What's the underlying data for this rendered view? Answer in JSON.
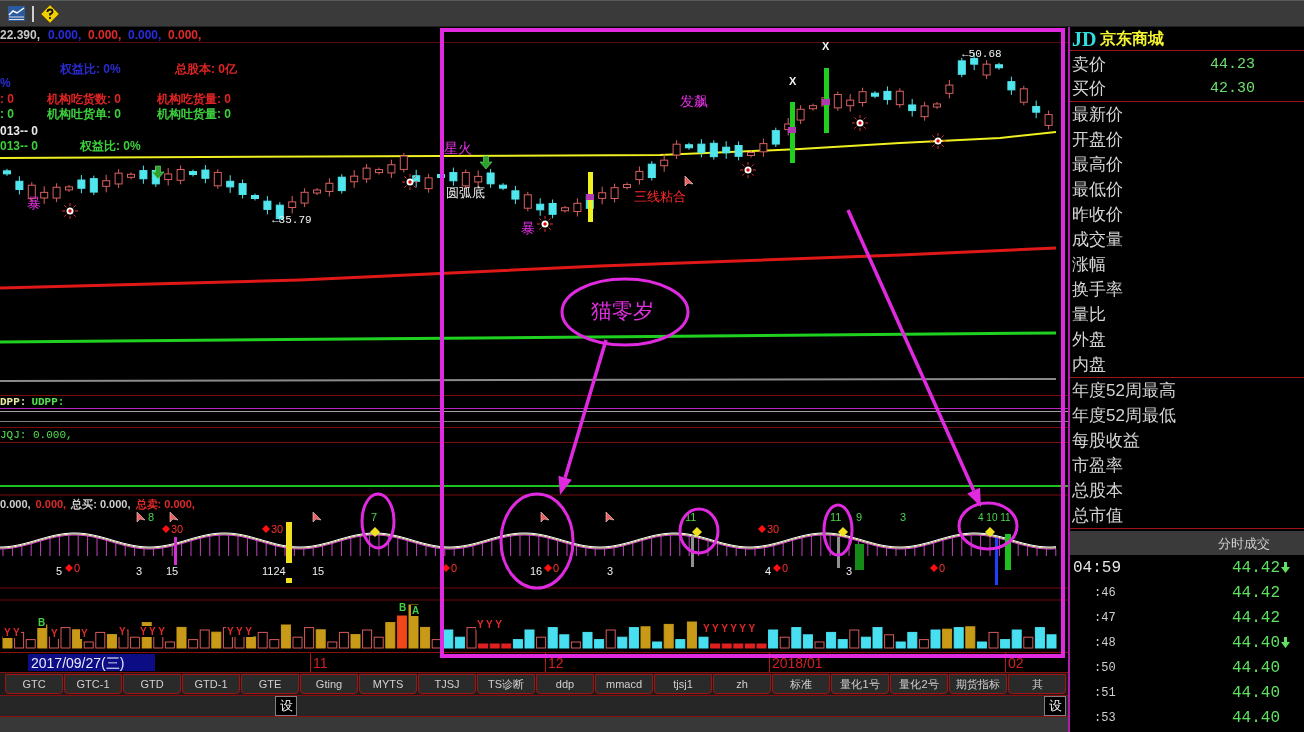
{
  "price_panel": {
    "readout": [
      {
        "text": "22.390,",
        "color": "#c8c8c8"
      },
      {
        "text": "0.000,",
        "color": "#2a2ae0"
      },
      {
        "text": "0.000,",
        "color": "#e02a2a"
      },
      {
        "text": "0.000,",
        "color": "#2a2ae0"
      },
      {
        "text": "0.000,",
        "color": "#e02a2a"
      }
    ],
    "legend": [
      {
        "items": [
          {
            "text": "权益比: 0%",
            "color": "#2a2ad0"
          },
          {
            "text": "总股本: 0亿",
            "color": "#e02424"
          }
        ]
      },
      {
        "items": [
          {
            "text": "%",
            "color": "#2a2ad0"
          }
        ]
      },
      {
        "items": [
          {
            "text": ": 0",
            "color": "#e02424"
          },
          {
            "text": "机构吃货数: 0",
            "color": "#e02424"
          },
          {
            "text": "机构吃货量: 0",
            "color": "#e02424"
          }
        ]
      },
      {
        "items": [
          {
            "text": ": 0",
            "color": "#3cd03c"
          },
          {
            "text": "机构吐货单: 0",
            "color": "#3cd03c"
          },
          {
            "text": "机构吐货量: 0",
            "color": "#3cd03c"
          }
        ]
      },
      {
        "items": [
          {
            "text": "013-- 0",
            "color": "#e8e8e8"
          }
        ]
      },
      {
        "items": [
          {
            "text": "013-- 0",
            "color": "#3cd03c"
          },
          {
            "text": "权益比: 0%",
            "color": "#3cd03c"
          }
        ]
      }
    ],
    "signals": [
      {
        "text": "暴",
        "kind": "pattern"
      },
      {
        "text": "←35.79",
        "kind": "price"
      },
      {
        "text": "星火",
        "kind": "pattern"
      },
      {
        "text": "圆弧底",
        "kind": "shape"
      },
      {
        "text": "暴",
        "kind": "pattern"
      },
      {
        "text": "三线粘合",
        "kind": "warning"
      },
      {
        "text": "发飙",
        "kind": "pattern"
      },
      {
        "text": "X",
        "kind": "cross"
      },
      {
        "text": "X",
        "kind": "cross"
      },
      {
        "text": "←50.68",
        "kind": "price"
      }
    ]
  },
  "dpp_panel": {
    "readout": [
      {
        "text": "DPP:",
        "color": "#e8e8a0"
      },
      {
        "text": "UDPP:",
        "color": "#50e050"
      }
    ]
  },
  "jqj_panel": {
    "readout": "JQJ: 0.000,"
  },
  "indicator_panel": {
    "readout": [
      {
        "text": "0.000,",
        "color": "#d0d0d0"
      },
      {
        "text": "0.000,",
        "color": "#e02a2a"
      },
      {
        "text": "总买: 0.000,",
        "color": "#d0d0d0"
      },
      {
        "text": "总卖: 0.000,",
        "color": "#e02a2a"
      }
    ],
    "labels": [
      {
        "text": "8",
        "kind": "signal"
      },
      {
        "text": "7",
        "kind": "signal"
      },
      {
        "text": "11",
        "kind": "signal"
      },
      {
        "text": "11",
        "kind": "signal"
      },
      {
        "text": "9",
        "kind": "signal"
      },
      {
        "text": "3",
        "kind": "signal"
      },
      {
        "text": "4 10 11",
        "kind": "signal"
      },
      {
        "text": "30",
        "kind": "diamond"
      },
      {
        "text": "30",
        "kind": "diamond"
      },
      {
        "text": "30",
        "kind": "diamond"
      },
      {
        "text": "5",
        "kind": "count"
      },
      {
        "text": "0",
        "kind": "diamond"
      },
      {
        "text": "3",
        "kind": "count"
      },
      {
        "text": "15",
        "kind": "count"
      },
      {
        "text": "1124",
        "kind": "count"
      },
      {
        "text": "15",
        "kind": "count"
      },
      {
        "text": "0",
        "kind": "diamond"
      },
      {
        "text": "16",
        "kind": "count"
      },
      {
        "text": "0",
        "kind": "diamond"
      },
      {
        "text": "3",
        "kind": "count"
      },
      {
        "text": "4",
        "kind": "count"
      },
      {
        "text": "0",
        "kind": "diamond"
      },
      {
        "text": "3",
        "kind": "count"
      },
      {
        "text": "0",
        "kind": "diamond"
      }
    ]
  },
  "volume_panel": {
    "labels": [
      {
        "text": "Y Y",
        "color": "#e02a2a"
      },
      {
        "text": "B",
        "color": "#40d040"
      },
      {
        "text": "Y",
        "color": "#e02a2a"
      },
      {
        "text": "Y",
        "color": "#e02a2a"
      },
      {
        "text": "Y",
        "color": "#e02a2a"
      },
      {
        "text": "Y Y Y",
        "color": "#e02a2a"
      },
      {
        "text": "Y Y Y",
        "color": "#e02a2a"
      },
      {
        "text": "B",
        "color": "#40d040"
      },
      {
        "text": "A",
        "color": "#40d040"
      },
      {
        "text": "Y Y Y",
        "color": "#e02a2a"
      },
      {
        "text": "Y Y Y Y Y Y",
        "color": "#e02a2a"
      }
    ]
  },
  "annotation": {
    "label": "猫零岁"
  },
  "date_axis": {
    "cursor_date": "2017/09/27(三)",
    "months": [
      "11",
      "12",
      "2018/01",
      "02"
    ]
  },
  "tabs": [
    "GTC",
    "GTC-1",
    "GTD",
    "GTD-1",
    "GTE",
    "Gting",
    "MYTS",
    "TJSJ",
    "TS诊断",
    "ddp",
    "mmacd",
    "tjsj1",
    "zh",
    "标准",
    "量化1号",
    "量化2号",
    "期货指标",
    "其"
  ],
  "settings_buttons": [
    "设",
    "设"
  ],
  "quote_panel": {
    "symbol": "JD",
    "name": "京东商城",
    "quotes": [
      {
        "label": "卖价",
        "value": "44.23"
      },
      {
        "label": "买价",
        "value": "42.30"
      }
    ],
    "fields": [
      "最新价",
      "开盘价",
      "最高价",
      "最低价",
      "昨收价",
      "成交量",
      "涨幅",
      "换手率",
      "量比",
      "外盘",
      "内盘"
    ],
    "stats": [
      "年度52周最高",
      "年度52周最低",
      "每股收益",
      "市盈率",
      "总股本",
      "总市值"
    ]
  },
  "trades": {
    "title": "分时成交",
    "rows": [
      {
        "time": "04:59",
        "price": "44.42",
        "down": true
      },
      {
        "time": ":46",
        "price": "44.42",
        "down": false
      },
      {
        "time": ":47",
        "price": "44.42",
        "down": false
      },
      {
        "time": ":48",
        "price": "44.40",
        "down": true
      },
      {
        "time": ":50",
        "price": "44.40",
        "down": false
      },
      {
        "time": ":51",
        "price": "44.40",
        "down": false
      },
      {
        "time": ":53",
        "price": "44.40",
        "down": false
      }
    ]
  }
}
